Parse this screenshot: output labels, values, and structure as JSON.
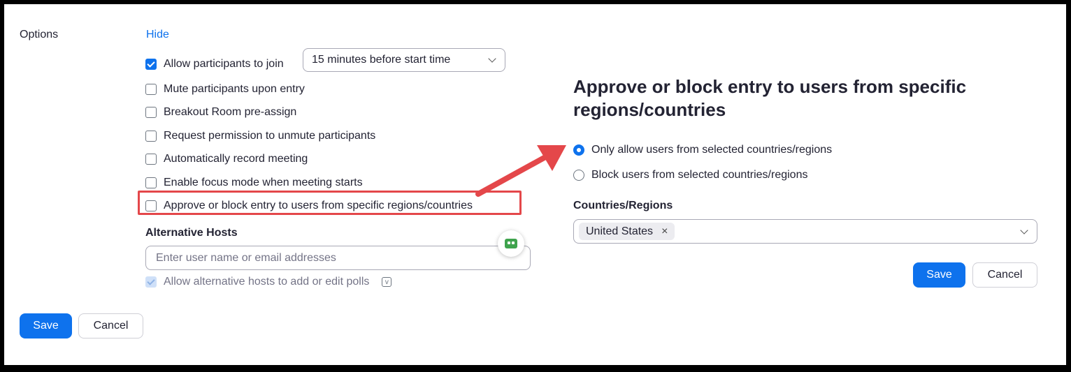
{
  "colors": {
    "accent": "#0e72ed",
    "annotation_red": "#e4474a"
  },
  "options": {
    "label": "Options",
    "hide_link": "Hide",
    "checkboxes": [
      {
        "label": "Allow participants to join",
        "checked": true
      },
      {
        "label": "Mute participants upon entry",
        "checked": false
      },
      {
        "label": "Breakout Room pre-assign",
        "checked": false
      },
      {
        "label": "Request permission to unmute participants",
        "checked": false
      },
      {
        "label": "Automatically record meeting",
        "checked": false
      },
      {
        "label": "Enable focus mode when meeting starts",
        "checked": false
      },
      {
        "label": "Approve or block entry to users from specific regions/countries",
        "checked": false
      }
    ],
    "join_time_select": "15 minutes before start time"
  },
  "alternative_hosts": {
    "label": "Alternative Hosts",
    "input_placeholder": "Enter user name or email addresses",
    "allow_polls_label": "Allow alternative hosts to add or edit polls",
    "allow_polls_checked": true,
    "info_icon": "v"
  },
  "footer": {
    "save": "Save",
    "cancel": "Cancel"
  },
  "panel": {
    "title": "Approve or block entry to users from specific regions/countries",
    "radios": [
      {
        "label": "Only allow users from selected countries/regions",
        "selected": true
      },
      {
        "label": "Block users from selected countries/regions",
        "selected": false
      }
    ],
    "countries_label": "Countries/Regions",
    "selected_country": "United States",
    "remove_icon": "×",
    "save": "Save",
    "cancel": "Cancel"
  },
  "icons": {
    "dropdown": "chevron-down-icon",
    "extension": "extension-badge-icon",
    "annotation": "red-arrow-annotation"
  }
}
